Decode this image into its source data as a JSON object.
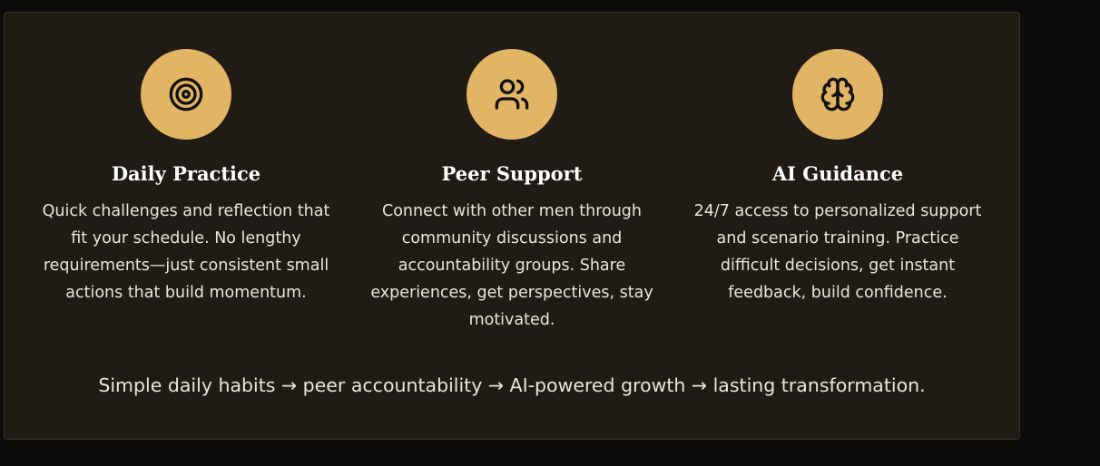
{
  "features": [
    {
      "icon": "target-icon",
      "title": "Daily Practice",
      "description": "Quick challenges and reflection that fit your schedule. No lengthy requirements—just consistent small actions that build momentum."
    },
    {
      "icon": "users-icon",
      "title": "Peer Support",
      "description": "Connect with other men through community discussions and accountability groups. Share experiences, get perspectives, stay motivated."
    },
    {
      "icon": "brain-icon",
      "title": "AI Guidance",
      "description": "24/7 access to personalized support and scenario training. Practice difficult decisions, get instant feedback, build confidence."
    }
  ],
  "tagline": "Simple daily habits → peer accountability → AI-powered growth → lasting transformation.",
  "colors": {
    "background": "#0d0c0b",
    "panel": "#201b14",
    "accent": "#e2b565",
    "title": "#ffffff",
    "body_text": "#ece6d9"
  }
}
